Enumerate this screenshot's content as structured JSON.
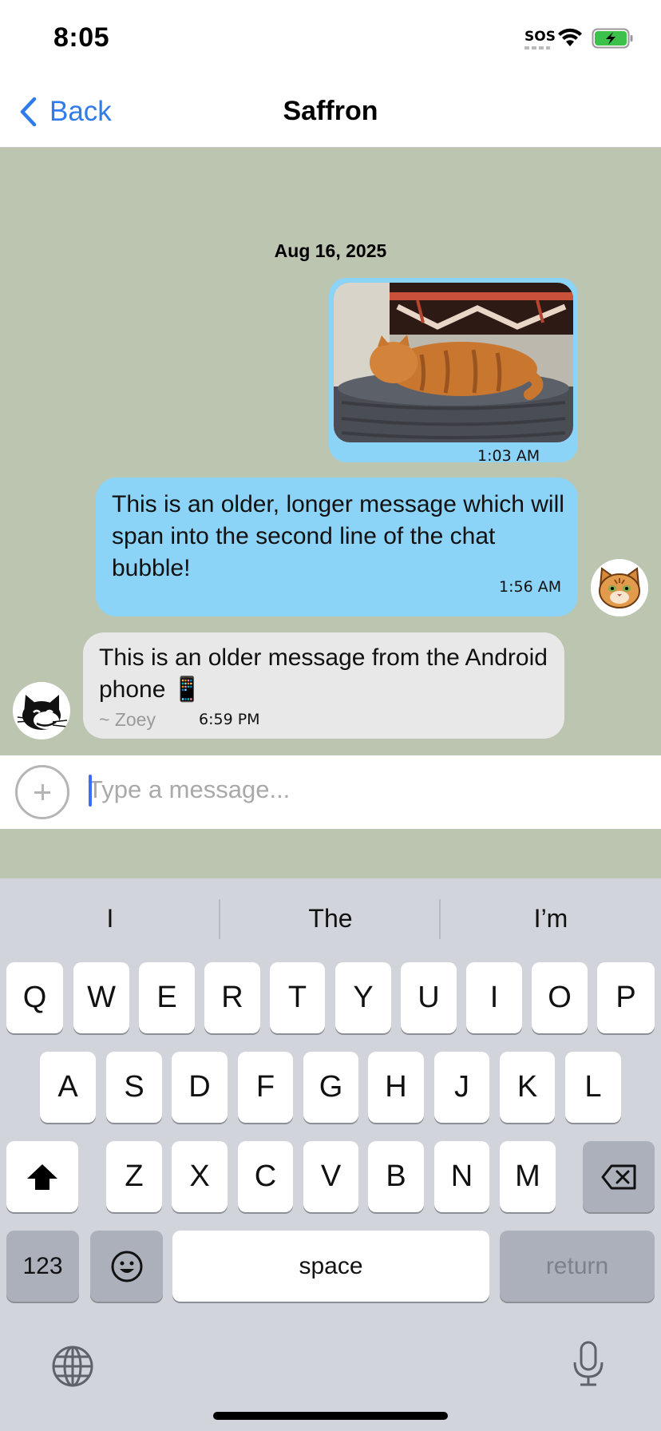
{
  "status_bar": {
    "time": "8:05",
    "carrier_text": "SOS",
    "icons": [
      "wifi-icon",
      "battery-charging-icon"
    ]
  },
  "nav": {
    "back_label": "Back",
    "title": "Saffron"
  },
  "chat": {
    "date_separator": "Aug 16, 2025",
    "messages": [
      {
        "direction": "outgoing",
        "kind": "image",
        "time": "1:03 AM"
      },
      {
        "direction": "outgoing",
        "kind": "text",
        "text": "This is an older, longer message which will span into the second line of the chat bubble!",
        "time": "1:56 AM"
      },
      {
        "direction": "incoming",
        "kind": "text",
        "text": "This is an older message from the Android phone 📱",
        "sender": "~ Zoey",
        "time": "6:59 PM"
      }
    ]
  },
  "composer": {
    "placeholder": "Type a message...",
    "value": ""
  },
  "keyboard": {
    "suggestions": [
      "I",
      "The",
      "I’m"
    ],
    "row1": [
      "Q",
      "W",
      "E",
      "R",
      "T",
      "Y",
      "U",
      "I",
      "O",
      "P"
    ],
    "row2": [
      "A",
      "S",
      "D",
      "F",
      "G",
      "H",
      "J",
      "K",
      "L"
    ],
    "row3": [
      "Z",
      "X",
      "C",
      "V",
      "B",
      "N",
      "M"
    ],
    "numbers_label": "123",
    "space_label": "space",
    "return_label": "return"
  },
  "colors": {
    "accent": "#2f7bec",
    "chat_background": "#bcc5b0",
    "outgoing_bubble": "#8cd3f8",
    "incoming_bubble": "#e8e8e8",
    "keyboard_background": "#d1d4da"
  }
}
